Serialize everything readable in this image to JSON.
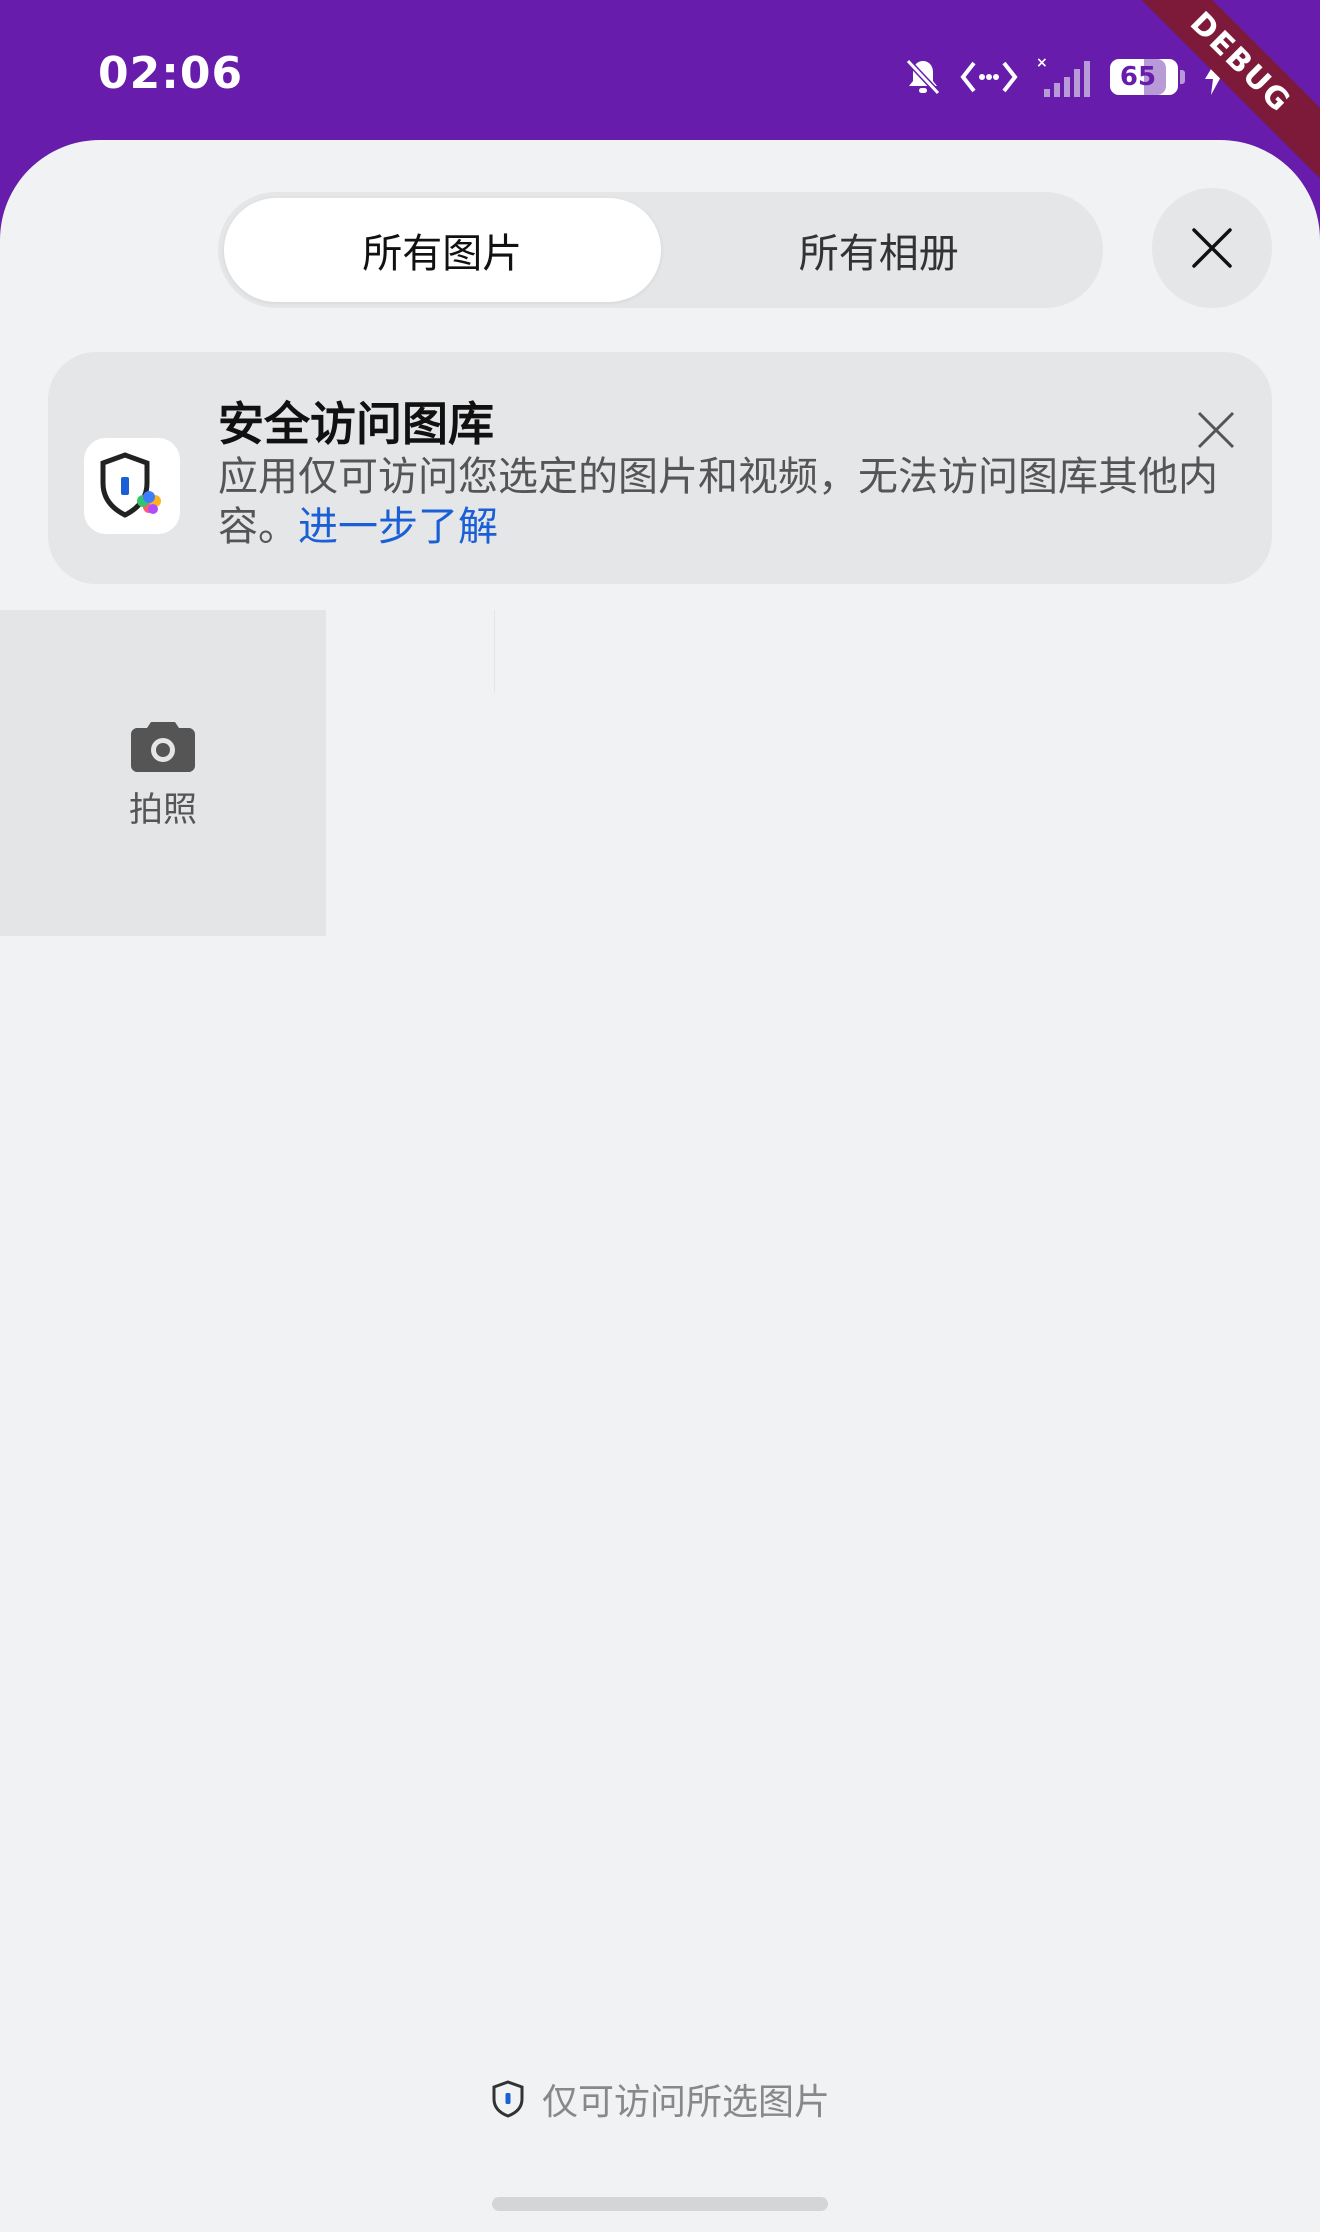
{
  "status_bar": {
    "time": "02:06",
    "battery": "65",
    "icons": [
      "bell-muted-icon",
      "data-transfer-icon",
      "no-signal-icon",
      "battery-icon",
      "charging-icon"
    ]
  },
  "debug_ribbon": "DEBUG",
  "tabs": [
    {
      "label": "所有图片",
      "active": true
    },
    {
      "label": "所有相册",
      "active": false
    }
  ],
  "banner": {
    "title": "安全访问图库",
    "description": "应用仅可访问您选定的图片和视频，无法访问图库其他内容。",
    "link": "进一步了解"
  },
  "camera_tile": {
    "label": "拍照"
  },
  "footer": {
    "note": "仅可访问所选图片"
  },
  "colors": {
    "status_bar": "#671cab",
    "sheet_background": "#f1f2f4",
    "link": "#1a5fd6",
    "debug_ribbon": "#7d1a3a"
  }
}
